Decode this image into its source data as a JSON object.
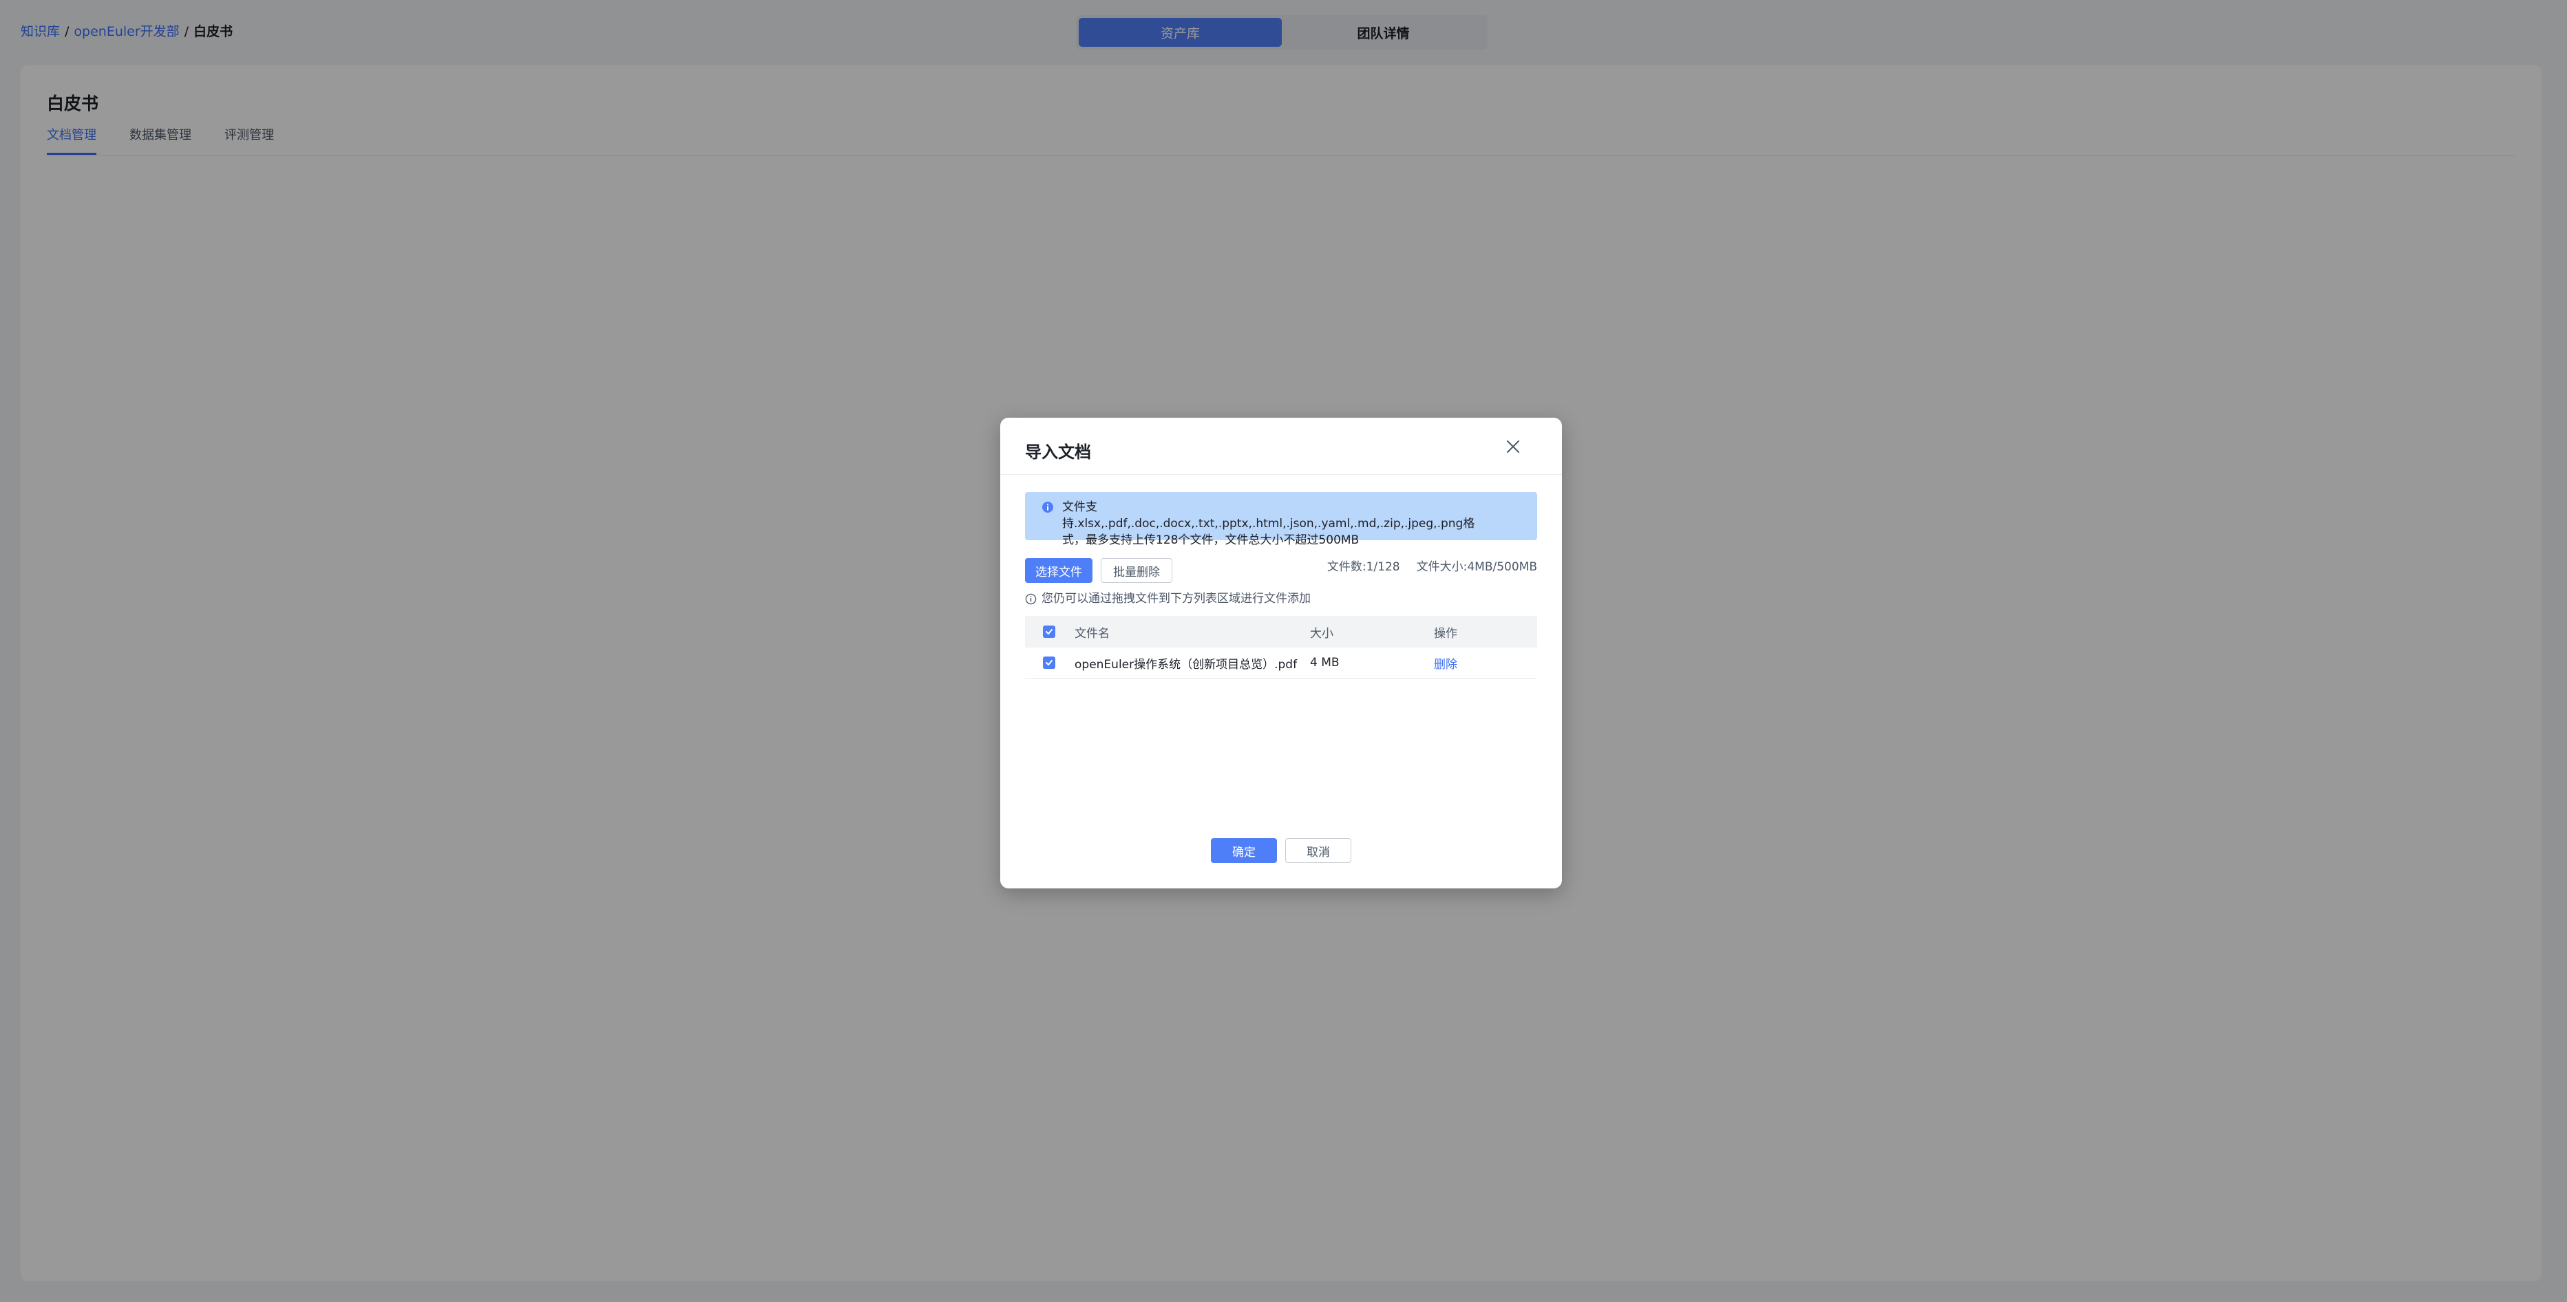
{
  "breadcrumb": {
    "items": [
      "知识库",
      "openEuler开发部"
    ],
    "separator": "/",
    "current": "白皮书"
  },
  "top_tabs": [
    {
      "label": "资产库",
      "active": true
    },
    {
      "label": "团队详情",
      "active": false
    }
  ],
  "page": {
    "title": "白皮书",
    "tabs": [
      {
        "label": "文档管理",
        "active": true
      },
      {
        "label": "数据集管理",
        "active": false
      },
      {
        "label": "评测管理",
        "active": false
      }
    ]
  },
  "dialog": {
    "title": "导入文档",
    "close_icon": "close-icon",
    "info_text": "文件支持.xlsx,.pdf,.doc,.docx,.txt,.pptx,.html,.json,.yaml,.md,.zip,.jpeg,.png格式，最多支持上传128个文件，文件总大小不超过500MB",
    "select_button": "选择文件",
    "batch_delete_button": "批量删除",
    "file_count": "文件数:1/128",
    "file_size": "文件大小:4MB/500MB",
    "drag_hint": "您仍可以通过拖拽文件到下方列表区域进行文件添加",
    "table": {
      "headers": {
        "name": "文件名",
        "size": "大小",
        "op": "操作"
      },
      "rows": [
        {
          "name": "openEuler操作系统（创新项目总览）.pdf",
          "size": "4 MB",
          "op": "删除",
          "checked": true
        }
      ]
    },
    "confirm_button": "确定",
    "cancel_button": "取消"
  },
  "colors": {
    "primary": "#4f7ff8",
    "link": "#3b6ff6",
    "alert_bg": "#b9d6fb"
  }
}
